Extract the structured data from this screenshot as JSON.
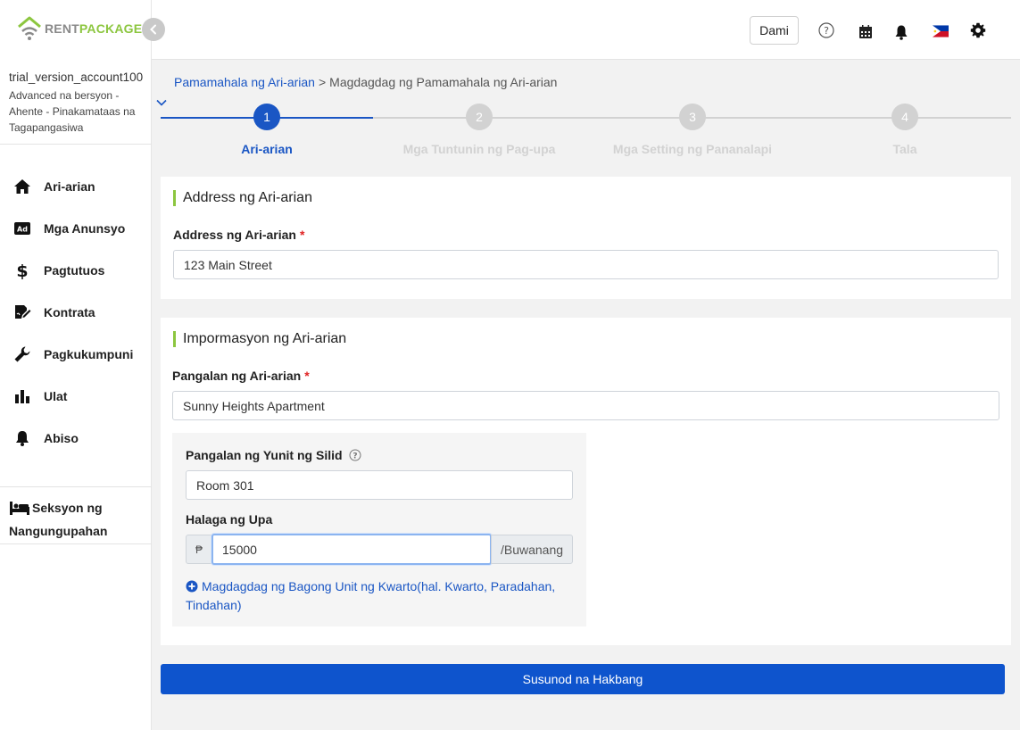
{
  "app": {
    "logo_rent": "RENT",
    "logo_package": "PACKAGE"
  },
  "account": {
    "name": "trial_version_account100",
    "plan": "Advanced na bersyon - Ahente - Pinakamataas na Tagapangasiwa"
  },
  "sidebar": {
    "items": [
      {
        "label": "Ari-arian",
        "icon": "home-icon"
      },
      {
        "label": "Mga Anunsyo",
        "icon": "ad-icon"
      },
      {
        "label": "Pagtutuos",
        "icon": "dollar-icon"
      },
      {
        "label": "Kontrata",
        "icon": "contract-icon"
      },
      {
        "label": "Pagkukumpuni",
        "icon": "wrench-icon"
      },
      {
        "label": "Ulat",
        "icon": "bar-chart-icon"
      },
      {
        "label": "Abiso",
        "icon": "bell-icon"
      }
    ],
    "tenant_section": "Seksyon ng Nangungupahan"
  },
  "header": {
    "dami_label": "Dami",
    "icons": [
      "help-icon",
      "calendar-icon",
      "bell-icon",
      "flag-philippines-icon",
      "gear-icon"
    ]
  },
  "breadcrumb": {
    "parent": "Pamamahala ng Ari-arian",
    "separator": ">",
    "current": "Magdagdag ng Pamamahala ng Ari-arian"
  },
  "stepper": {
    "active_index": 0,
    "steps": [
      {
        "number": "1",
        "label": "Ari-arian"
      },
      {
        "number": "2",
        "label": "Mga Tuntunin ng Pag-upa"
      },
      {
        "number": "3",
        "label": "Mga Setting ng Pananalapi"
      },
      {
        "number": "4",
        "label": "Tala"
      }
    ]
  },
  "address_section": {
    "title": "Address ng Ari-arian",
    "field_label": "Address ng Ari-arian",
    "required_mark": "*",
    "value": "123 Main Street"
  },
  "info_section": {
    "title": "Impormasyon ng Ari-arian",
    "name_label": "Pangalan ng Ari-arian",
    "required_mark": "*",
    "name_value": "Sunny Heights Apartment",
    "unit": {
      "room_label": "Pangalan ng Yunit ng Silid",
      "room_value": "Room 301",
      "rent_label": "Halaga ng Upa",
      "currency_symbol": "₱",
      "rent_value": "15000",
      "period_suffix": "/Buwanang",
      "add_unit_link": "Magdagdag ng Bagong Unit ng Kwarto(hal. Kwarto, Paradahan, Tindahan)"
    }
  },
  "actions": {
    "next_label": "Susunod na Hakbang"
  },
  "colors": {
    "primary": "#0e54cd",
    "link": "#1a56c4",
    "accent_green": "#8cc63f",
    "step_inactive": "#d2d2d2",
    "required": "#e02424"
  }
}
